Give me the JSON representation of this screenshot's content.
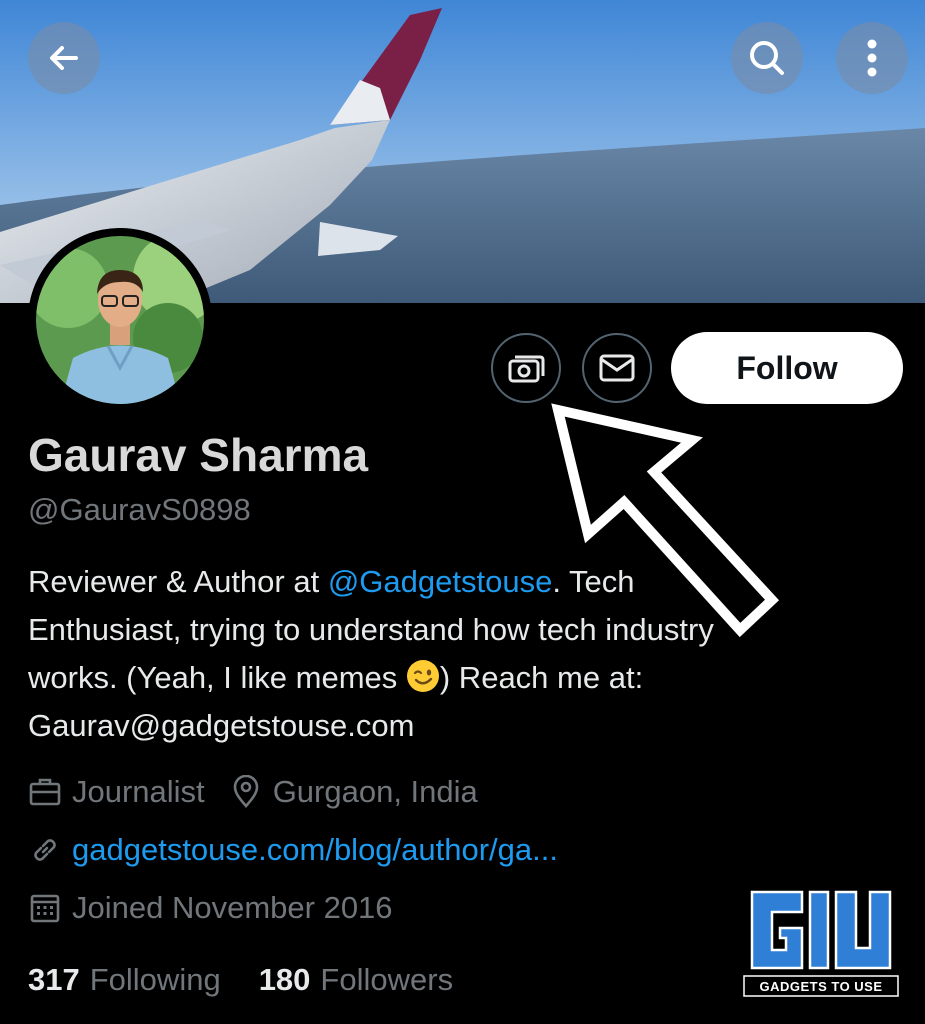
{
  "profile": {
    "name": "Gaurav Sharma",
    "handle": "@GauravS0898",
    "bio": {
      "line1_before": "Reviewer & Author at ",
      "mention": "@Gadgetstouse",
      "line1_after": ". Tech",
      "line2": "Enthusiast, trying to understand how tech industry",
      "line3_before": "works. (Yeah, I like memes ",
      "line3_after": ") Reach me at:",
      "line4": "Gaurav@gadgetstouse.com"
    },
    "profession": "Journalist",
    "location": "Gurgaon, India",
    "website": "gadgetstouse.com/blog/author/ga...",
    "joined": "Joined November 2016"
  },
  "stats": {
    "following_count": "317",
    "following_label": "Following",
    "followers_count": "180",
    "followers_label": "Followers"
  },
  "actions": {
    "follow_label": "Follow"
  },
  "icons": {
    "back": "arrow-left-icon",
    "search": "search-icon",
    "more": "more-vertical-icon",
    "tip": "tip-money-icon",
    "message": "envelope-icon",
    "profession": "briefcase-icon",
    "location": "location-pin-icon",
    "link": "link-icon",
    "calendar": "calendar-icon"
  },
  "watermark": {
    "logo": "G/U",
    "text": "GADGETS TO USE"
  },
  "colors": {
    "background": "#000000",
    "link": "#1d9bf0",
    "secondary_text": "#71767b",
    "follow_button": "#ffffff"
  }
}
